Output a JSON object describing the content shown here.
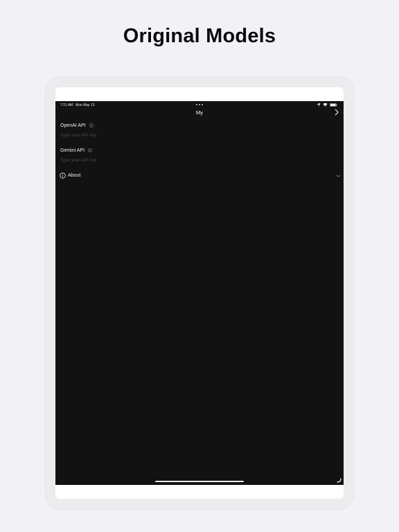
{
  "promo": {
    "headline": "Original Models"
  },
  "status_bar": {
    "time": "7:21 AM",
    "date": "Mon May 13"
  },
  "nav": {
    "title": "My"
  },
  "fields": [
    {
      "label": "OpenAI API",
      "placeholder": "Type your API key",
      "value": ""
    },
    {
      "label": "Gemini API",
      "placeholder": "Type your API key",
      "value": ""
    }
  ],
  "about": {
    "label": "About"
  },
  "icons": {
    "info": "info-circle-icon",
    "forward": "chevron-right-icon",
    "expand": "chevron-down-icon",
    "about": "info-circle-icon"
  },
  "colors": {
    "page_background": "#f2f2f6",
    "screen_background": "#121212",
    "text_primary": "#ffffff",
    "placeholder": "#4a4a4c"
  }
}
